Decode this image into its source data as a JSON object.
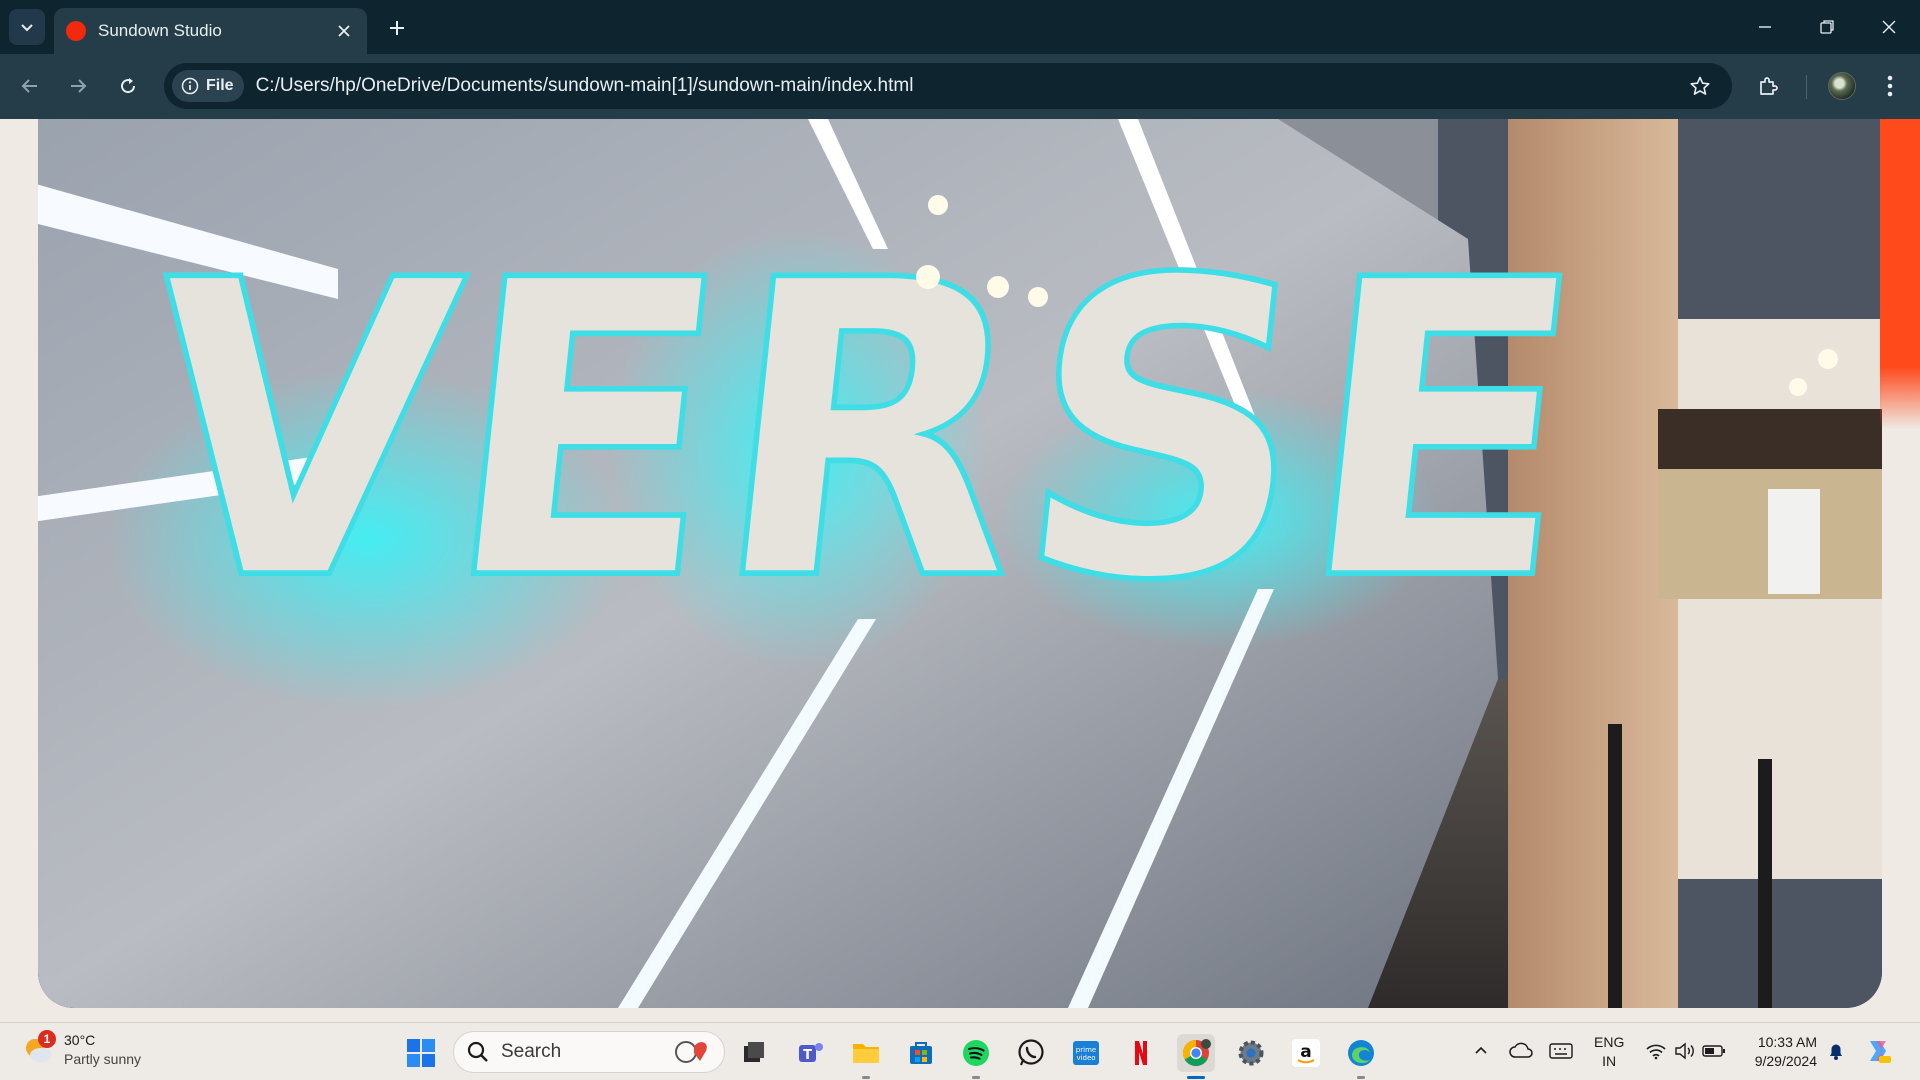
{
  "window": {
    "tab_title": "Sundown Studio",
    "favicon_color": "#f2290e"
  },
  "toolbar": {
    "site_chip_label": "File",
    "url": "C:/Users/hp/OneDrive/Documents/sundown-main[1]/sundown-main/index.html"
  },
  "page": {
    "hero_signage_text": "VERSE",
    "accent_color": "#ff4a1c"
  },
  "taskbar": {
    "weather": {
      "temp": "30°C",
      "condition": "Partly sunny",
      "badge": "1"
    },
    "search_placeholder": "Search",
    "apps": [
      "file-explorer",
      "teams",
      "folder",
      "microsoft-store",
      "spotify",
      "whatsapp",
      "prime-video",
      "netflix",
      "chrome",
      "settings",
      "amazon",
      "edge"
    ],
    "tray": {
      "lang_line1": "ENG",
      "lang_line2": "IN",
      "time": "10:33 AM",
      "date": "9/29/2024"
    }
  }
}
